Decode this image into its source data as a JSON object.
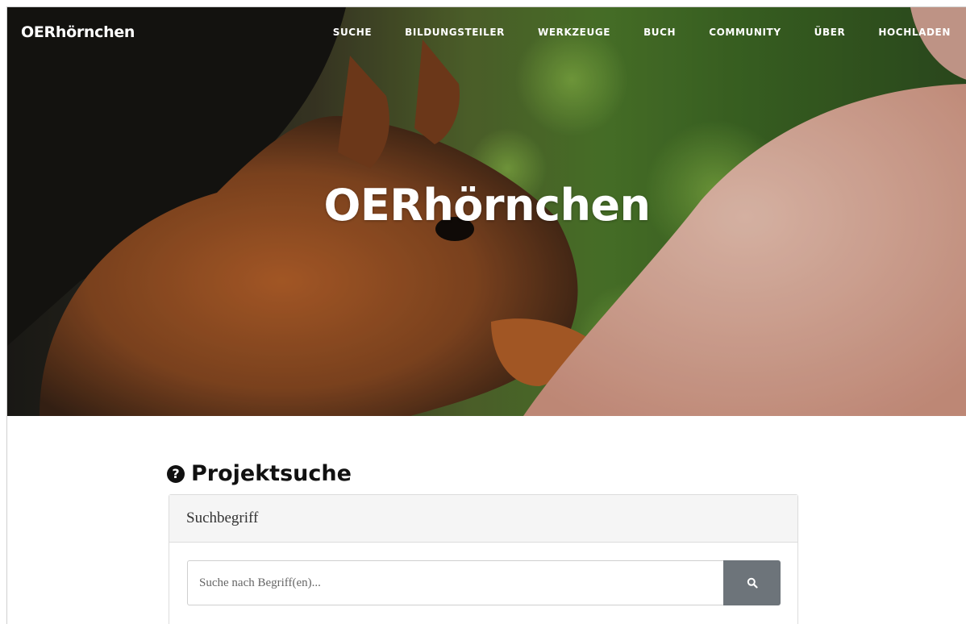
{
  "brand": "OERhörnchen",
  "nav": [
    "SUCHE",
    "BILDUNGSTEILER",
    "WERKZEUGE",
    "BUCH",
    "COMMUNITY",
    "ÜBER",
    "HOCHLADEN"
  ],
  "hero": {
    "title": "OERhörnchen"
  },
  "search_section": {
    "title": "Projektsuche",
    "help_icon": "question-circle-icon",
    "panel_heading": "Suchbegriff",
    "input_placeholder": "Suche nach Begriff(en)...",
    "input_value": "",
    "button_icon": "search-icon"
  },
  "colors": {
    "button_bg": "#6d747a",
    "panel_header_bg": "#f5f5f5",
    "text_dark": "#111111"
  }
}
